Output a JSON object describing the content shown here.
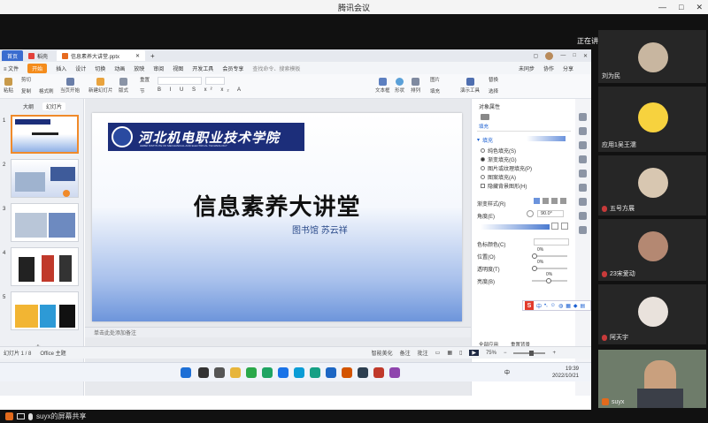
{
  "meeting": {
    "title": "腾讯会议",
    "window_buttons": [
      "—",
      "□",
      "✕"
    ],
    "speaking_label": "正在讲话: suyxc",
    "share_label": "suyx的屏幕共享"
  },
  "wps": {
    "tabs": {
      "home": "首页",
      "wps": "稻壳",
      "doc": "信息素养大讲堂.pptx"
    },
    "menu": {
      "file": "≡ 文件",
      "items": [
        "开始",
        "插入",
        "设计",
        "切换",
        "动画",
        "放映",
        "审阅",
        "视图",
        "开发工具",
        "会员专享"
      ],
      "search": "查找命令、搜索模板",
      "right": [
        "未同步",
        "协作",
        "分享"
      ]
    },
    "ribbon": {
      "paste": "粘贴",
      "cut": "剪切",
      "copy": "复制",
      "format_painter": "格式刷",
      "from_current": "当页开始",
      "new_slide": "新建幻灯片",
      "layout": "版式",
      "section": "节",
      "reset": "重置",
      "textbox": "文本框",
      "shape": "形状",
      "arrange": "排列",
      "picture": "图片",
      "fill": "填充",
      "presenter": "演示工具",
      "replace": "替换",
      "select": "选择"
    },
    "left_tabs": [
      "大纲",
      "幻灯片"
    ],
    "slide": {
      "school_cn": "河北机电职业技术学院",
      "school_en": "HEBEI INSTITUTE OF MECHANICAL AND ELECTRICAL TECHNOLOGY",
      "title": "信息素养大讲堂",
      "subtitle": "图书馆  苏云祥"
    },
    "notes_placeholder": "单击此处添加备注",
    "taskpane": {
      "tabs": [
        "对象属性"
      ],
      "fill_tab": "填充",
      "section": "填充",
      "options": [
        "纯色填充(S)",
        "渐变填充(G)",
        "图片或纹理填充(P)",
        "图案填充(A)"
      ],
      "hide_bg": "隐藏背景图形(H)",
      "gradient_style": "渐变样式(R)",
      "angle_label": "角度(E)",
      "angle_value": "90.0°",
      "color_label": "色标颜色(C)",
      "position_label": "位置(O)",
      "position_value": "0%",
      "transparency_label": "透明度(T)",
      "transparency_value": "0%",
      "brightness_label": "亮度(B)",
      "brightness_value": "0%",
      "apply_all_bottom": "全部应用",
      "reset_bg": "重置背景"
    },
    "status": {
      "slide_count": "幻灯片 1 / 8",
      "theme": "Office 主题",
      "smart_beautify": "智能美化",
      "notes": "备注",
      "comments": "批注",
      "zoom": "75%"
    }
  },
  "taskbar": {
    "time": "19:39",
    "date": "2022/10/21",
    "ime": "中"
  },
  "ime_toolbar": {
    "logo": "S",
    "mode": "中"
  },
  "participants": [
    {
      "name": "刘为民"
    },
    {
      "name": "应用1吴王濡"
    },
    {
      "name": "五号方展"
    },
    {
      "name": "23宋爱动"
    },
    {
      "name": "阿天宇"
    },
    {
      "name": "suyx"
    }
  ]
}
